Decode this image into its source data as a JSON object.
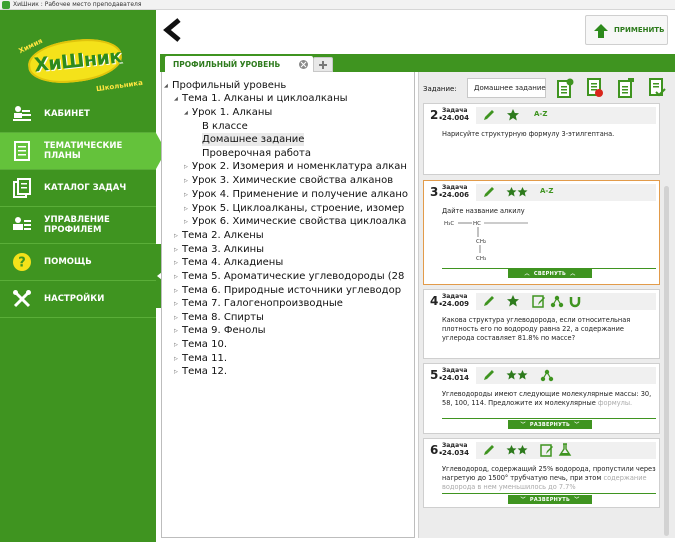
{
  "window": {
    "title": "ХиШник : Рабочее место преподавателя"
  },
  "logo": {
    "top_text": "Химия",
    "main_text": "ХиШник",
    "bottom_text": "Школьника"
  },
  "sidebar": {
    "items": [
      {
        "label": "КАБИНЕТ",
        "icon": "desk-icon"
      },
      {
        "label": "ТЕМАТИЧЕСКИЕ ПЛАНЫ",
        "icon": "plans-icon",
        "active": true
      },
      {
        "label": "КАТАЛОГ ЗАДАЧ",
        "icon": "catalog-icon"
      },
      {
        "label": "УПРАВЛЕНИЕ ПРОФИЛЕМ",
        "icon": "profile-icon"
      },
      {
        "label": "ПОМОЩЬ",
        "icon": "help-icon"
      },
      {
        "label": "НАСТРОЙКИ",
        "icon": "tools-icon"
      }
    ]
  },
  "toolbar": {
    "apply_label": "ПРИМЕНИТЬ"
  },
  "tabs": {
    "active_label": "ПРОФИЛЬНЫЙ УРОВЕНЬ"
  },
  "tree": {
    "rows": [
      "Профильный уровень",
      "Тема 1.  Алканы и циклоалканы",
      "Урок 1.  Алканы",
      "В классе",
      "Домашнее задание",
      "Проверочная работа",
      "Урок 2.  Изомерия и номенклатура алкан",
      "Урок 3.  Химические свойства алканов",
      "Урок 4.  Применение и получение алкано",
      "Урок 5.  Циклоалканы, строение, изомер",
      "Урок 6.  Химические свойства циклоалка",
      "Тема 2.  Алкены",
      "Тема 3.  Алкины",
      "Тема 4.  Алкадиены",
      "Тема 5.  Ароматические углеводороды (28",
      "Тема 6.  Природные источники углеводор",
      "Тема 7.  Галогенопроизводные",
      "Тема 8.  Спирты",
      "Тема 9.  Фенолы",
      "Тема 10.",
      "Тема 11.",
      "Тема 12."
    ]
  },
  "task_panel": {
    "label": "Задание:",
    "value": "Домашнее задание",
    "word": "Задача",
    "az": "A-Z",
    "collapse_label": "СВЕРНУТЬ",
    "expand_label": "РАЗВЕРНУТЬ",
    "cards": [
      {
        "num": "2.",
        "code": "24.004",
        "text": "Нарисуйте структурную формулу 3-этилгептана."
      },
      {
        "num": "3.",
        "code": "24.006",
        "text": "Дайте название алкилу",
        "formula": {
          "h3c": "H₃C",
          "hc": "HC",
          "ch2": "CH₂",
          "ch3": "CH₃"
        }
      },
      {
        "num": "4.",
        "code": "24.009",
        "text": "Какова структура углеводорода, если относительная плотность его по водороду равна 22, а содержание углерода составляет 81.8% по массе?"
      },
      {
        "num": "5.",
        "code": "24.014",
        "text": "Углеводороды имеют следующие молекулярные массы: 30, 58, 100, 114. Предложите их молекулярные",
        "faded": "формулы."
      },
      {
        "num": "6.",
        "code": "24.034",
        "text": "Углеводород, содержащий 25% водорода, пропустили через нагретую до 1500° трубчатую печь, при этом",
        "faded": "содержание водорода в нем уменьшилось до 7.7%"
      }
    ]
  },
  "colors": {
    "sidebar": "#3f9420",
    "active": "#64c23b",
    "accent": "#2d7a1c",
    "highlight": "#e29b4a"
  }
}
